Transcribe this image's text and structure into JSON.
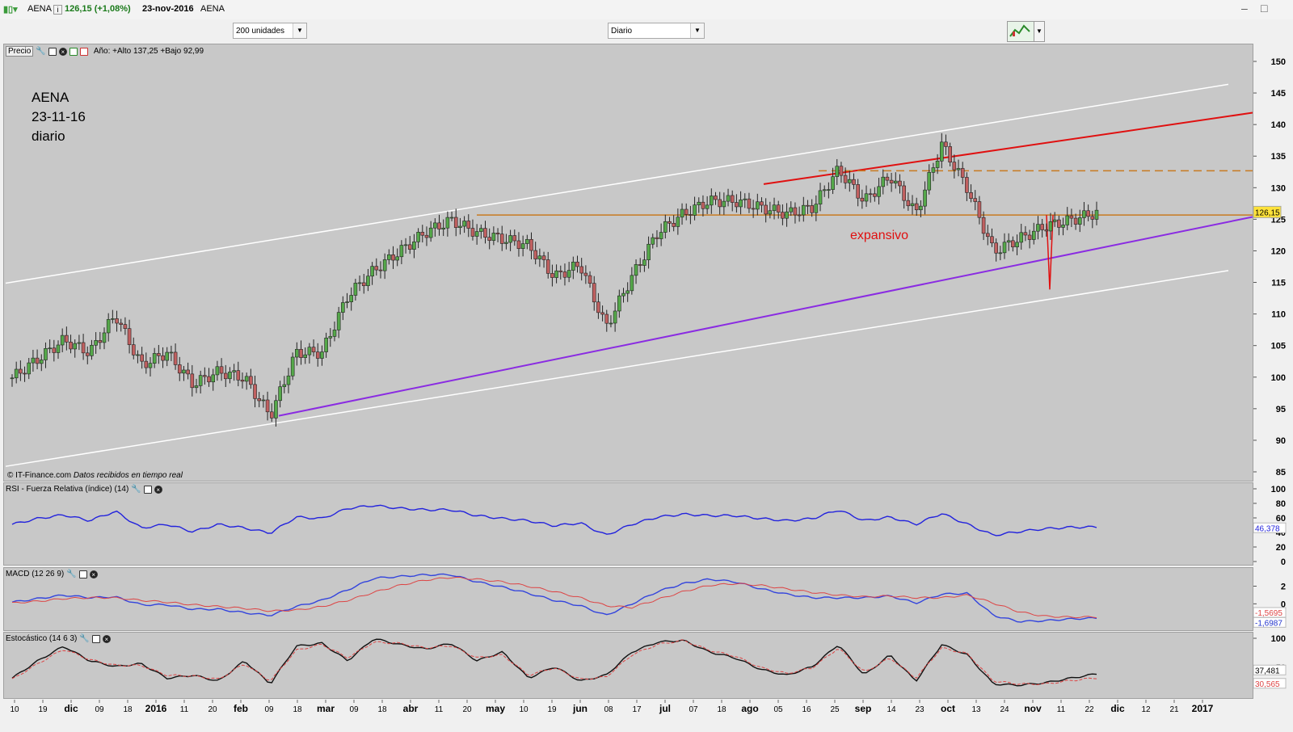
{
  "window": {
    "ticker": "AENA",
    "price_change": "126,15 (+1,08%)",
    "date": "23-nov-2016",
    "name": "AENA"
  },
  "toolbar": {
    "units_select": "200 unidades",
    "period_select": "Diario"
  },
  "price_panel": {
    "label": "Precio",
    "year_range": "Año: +Alto 137,25 +Bajo 92,99",
    "note_title": "AENA",
    "note_date": "23-11-16",
    "note_period": "diario",
    "annotation": "expansivo",
    "credit": "© IT-Finance.com",
    "credit_note": "Datos recibidos en tiempo real",
    "last_price_label": "126,15",
    "y_ticks": [
      "150",
      "145",
      "140",
      "135",
      "130",
      "125",
      "120",
      "115",
      "110",
      "105",
      "100",
      "95",
      "90",
      "85"
    ]
  },
  "rsi_panel": {
    "label": "RSI - Fuerza Relativa (índice) (14)",
    "value_label": "46,378",
    "y_ticks": [
      "100",
      "80",
      "60",
      "40",
      "20",
      "0"
    ]
  },
  "macd_panel": {
    "label": "MACD (12 26 9)",
    "value_signal": "-1,5695",
    "value_macd": "-1,6987",
    "y_ticks": [
      "2",
      "0",
      "-2"
    ]
  },
  "stoch_panel": {
    "label": "Estocástico (14 6 3)",
    "value_k": "37,481",
    "value_d": "30,565",
    "y_ticks": [
      "100",
      "50"
    ]
  },
  "x_axis": {
    "labels": [
      "10",
      "19",
      "dic",
      "09",
      "18",
      "2016",
      "11",
      "20",
      "feb",
      "09",
      "18",
      "mar",
      "09",
      "18",
      "abr",
      "11",
      "20",
      "may",
      "10",
      "19",
      "jun",
      "08",
      "17",
      "jul",
      "07",
      "18",
      "ago",
      "05",
      "16",
      "25",
      "sep",
      "14",
      "23",
      "oct",
      "13",
      "24",
      "nov",
      "11",
      "22",
      "dic",
      "12",
      "21",
      "2017"
    ]
  },
  "colors": {
    "candle_up": "#55a84a",
    "candle_down": "#c06060",
    "channel": "#ffffff",
    "resistance": "#e01010",
    "support": "#8a2be2",
    "horizontal": "#c87a20",
    "rsi_line": "#2222dd",
    "macd_line": "#3344dd",
    "signal_line": "#dd4444"
  },
  "chart_data": {
    "type": "candlestick",
    "title": "AENA",
    "x": [
      "2015-11-10",
      "2015-11-19",
      "2015-12-01",
      "2015-12-09",
      "2015-12-18",
      "2016-01-04",
      "2016-01-11",
      "2016-01-20",
      "2016-02-01",
      "2016-02-09",
      "2016-02-18",
      "2016-03-01",
      "2016-03-09",
      "2016-03-18",
      "2016-04-01",
      "2016-04-11",
      "2016-04-20",
      "2016-05-02",
      "2016-05-10",
      "2016-05-19",
      "2016-06-01",
      "2016-06-08",
      "2016-06-17",
      "2016-06-24",
      "2016-07-01",
      "2016-07-07",
      "2016-07-18",
      "2016-08-01",
      "2016-08-05",
      "2016-08-16",
      "2016-08-25",
      "2016-09-01",
      "2016-09-14",
      "2016-09-23",
      "2016-10-03",
      "2016-10-13",
      "2016-10-24",
      "2016-11-02",
      "2016-11-11",
      "2016-11-15",
      "2016-11-18",
      "2016-11-22",
      "2016-11-23"
    ],
    "close": [
      100,
      103,
      106,
      104,
      110,
      102,
      104,
      99,
      101,
      100,
      94,
      104,
      104,
      113,
      117,
      120,
      123,
      125,
      123,
      122,
      121,
      116,
      118,
      108,
      116,
      123,
      126,
      128,
      128,
      127,
      126,
      127,
      133,
      128,
      132,
      126,
      137,
      130,
      120,
      122,
      124,
      125,
      126.15
    ],
    "ylim": [
      85,
      150
    ],
    "rsi": [
      50,
      58,
      63,
      55,
      68,
      45,
      50,
      40,
      50,
      45,
      38,
      60,
      58,
      72,
      76,
      72,
      70,
      70,
      62,
      58,
      55,
      48,
      52,
      35,
      50,
      60,
      64,
      62,
      62,
      58,
      55,
      58,
      70,
      55,
      60,
      50,
      65,
      50,
      35,
      40,
      44,
      46,
      46.378
    ],
    "macd": [
      0.1,
      0.5,
      0.9,
      0.6,
      0.7,
      -0.2,
      -0.2,
      -0.7,
      -0.7,
      -1.1,
      -1.4,
      -0.4,
      0.3,
      1.5,
      2.8,
      3.0,
      3.2,
      3.2,
      2.4,
      1.8,
      1.1,
      0.3,
      -0.3,
      -1.4,
      -0.1,
      1.3,
      2.2,
      2.7,
      2.4,
      1.6,
      1.0,
      0.6,
      0.6,
      0.6,
      0.8,
      0.0,
      1.0,
      1.1,
      -1.4,
      -2.1,
      -2.0,
      -1.8,
      -1.6987
    ],
    "signal": [
      0.0,
      0.2,
      0.5,
      0.6,
      0.6,
      0.3,
      0.1,
      -0.2,
      -0.4,
      -0.6,
      -0.9,
      -0.8,
      -0.4,
      0.3,
      1.2,
      2.0,
      2.6,
      2.9,
      2.7,
      2.4,
      1.9,
      1.3,
      0.6,
      -0.3,
      -0.5,
      0.4,
      1.3,
      2.0,
      2.2,
      2.0,
      1.6,
      1.2,
      0.9,
      0.7,
      0.8,
      0.6,
      0.6,
      0.9,
      0.0,
      -1.0,
      -1.5,
      -1.6,
      -1.5695
    ],
    "stoch_k": [
      30,
      60,
      85,
      60,
      50,
      55,
      30,
      35,
      25,
      60,
      20,
      85,
      90,
      60,
      98,
      88,
      80,
      90,
      60,
      75,
      30,
      50,
      25,
      35,
      75,
      92,
      95,
      75,
      65,
      45,
      35,
      50,
      88,
      35,
      70,
      25,
      88,
      70,
      20,
      18,
      22,
      30,
      37.481
    ],
    "stoch_d": [
      28,
      55,
      80,
      62,
      52,
      52,
      35,
      34,
      28,
      55,
      25,
      78,
      88,
      65,
      92,
      90,
      82,
      86,
      65,
      70,
      35,
      48,
      28,
      32,
      70,
      88,
      95,
      78,
      68,
      48,
      38,
      48,
      82,
      40,
      65,
      30,
      82,
      72,
      25,
      20,
      20,
      26,
      30.565
    ]
  }
}
